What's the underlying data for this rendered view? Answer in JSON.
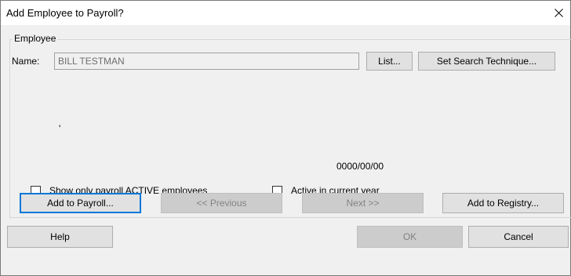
{
  "window": {
    "title": "Add Employee to Payroll?"
  },
  "employee_group": {
    "legend": "Employee",
    "name_label": "Name:",
    "name_value": "BILL TESTMAN",
    "list_button": "List...",
    "search_button": "Set Search Technique...",
    "tick": "'",
    "date": "0000/00/00"
  },
  "options": {
    "active_only_label": "Show only payroll ACTIVE employees",
    "active_only_checked": false,
    "active_year_label": "Active in current year",
    "active_year_checked": false
  },
  "actions": {
    "add_payroll": "Add to Payroll...",
    "previous": "<< Previous",
    "next": "Next >>",
    "add_registry": "Add to Registry..."
  },
  "footer": {
    "help": "Help",
    "ok": "OK",
    "cancel": "Cancel"
  },
  "icons": {
    "close": "close-icon"
  }
}
